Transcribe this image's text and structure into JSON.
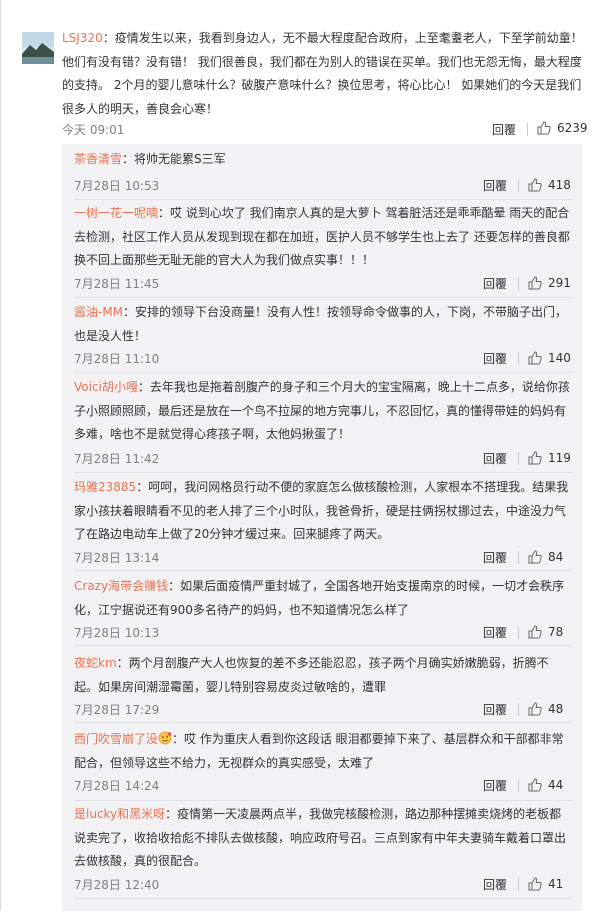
{
  "main_comment": {
    "username": "LSJ320",
    "text": "：疫情发生以来，我看到身边人，无不最大程度配合政府，上至耄耋老人，下至学前幼童！他们有没有错？没有错！ 我们很善良，我们都在为别人的错误在买单。我们也无怨无悔，最大程度的支持。 2个月的婴儿意味什么？破腹产意味什么？换位思考，将心比心！ 如果她们的今天是我们很多人的明天，善良会心寒！",
    "time": "今天 09:01",
    "reply_label": "回覆",
    "likes": "6239"
  },
  "replies": [
    {
      "username": "茶香清雪",
      "text": "：将帅无能累S三军",
      "time": "7月28日 10:53",
      "reply_label": "回覆",
      "likes": "418"
    },
    {
      "username": "一树一花一呢喃",
      "text": "：哎 说到心坎了 我们南京人真的是大萝卜 驾着脏活还是乖乖酷晕 雨天的配合去检测，社区工作人员从发现到现在都在加班，医护人员不够学生也上去了 还要怎样的善良都换不回上面那些无耻无能的官大人为我们做点实事！！！",
      "time": "7月28日 11:45",
      "reply_label": "回覆",
      "likes": "291"
    },
    {
      "username": "酱油-MM",
      "text": "：安排的领导下台没商量！没有人性！按领导命令做事的人，下岗，不带脑子出门，也是没人性！",
      "time": "7月28日 11:10",
      "reply_label": "回覆",
      "likes": "140"
    },
    {
      "username": "Voici胡小嘎",
      "text": "：去年我也是拖着剖腹产的身子和三个月大的宝宝隔离，晚上十二点多，说给你孩子小照顾照顾，最后还是放在一个鸟不拉屎的地方完事儿，不忍回忆，真的懂得带娃的妈妈有多难，啥也不是就觉得心疼孩子啊，太他妈揪蛋了！",
      "time": "7月28日 11:42",
      "reply_label": "回覆",
      "likes": "119"
    },
    {
      "username": "玛雅23885",
      "text": "：呵呵，我问网格员行动不便的家庭怎么做核酸检测，人家根本不搭理我。结果我家小孩扶着眼睛看不见的老人排了三个小时队，我爸骨折，硬是拄俩拐杖挪过去，中途没力气了在路边电动车上做了20分钟才缓过来。回来腿疼了两天。",
      "time": "7月28日 13:14",
      "reply_label": "回覆",
      "likes": "84"
    },
    {
      "username": "Crazy海带会赚钱",
      "text": "：如果后面疫情严重封城了，全国各地开始支援南京的时候，一切才会秩序化，江宁据说还有900多名待产的妈妈，也不知道情况怎么样了",
      "time": "7月28日 10:13",
      "reply_label": "回覆",
      "likes": "78"
    },
    {
      "username": "夜蛇km",
      "text": "：两个月剖腹产大人也恢复的差不多还能忍忍，孩子两个月确实娇嫩脆弱，折腾不起。如果房间潮湿霉菌，婴儿特别容易皮炎过敏啥的，遭罪",
      "time": "7月28日 17:29",
      "reply_label": "回覆",
      "likes": "48"
    },
    {
      "username": "西门吹雪崩了没",
      "text": "：哎 作为重庆人看到你这段话 眼泪都要掉下来了、基层群众和干部都非常配合，但领导这些不给力，无视群众的真实感受，太难了",
      "time": "7月28日 14:24",
      "reply_label": "回覆",
      "likes": "44",
      "emoji": "face-emoji-icon"
    },
    {
      "username": "是lucky和黑米呀",
      "text": "：疫情第一天凌晨两点半，我做完核酸检测，路边那种摆摊卖烧烤的老板都说卖完了，收拾收拾彪不排队去做核酸，响应政府号召。三点到家有中年夫妻骑车戴着口罩出去做核酸，真的很配合。",
      "time": "7月28日 12:40",
      "reply_label": "回覆",
      "likes": "41"
    }
  ],
  "colors": {
    "username": "#eb7350",
    "reply_bg": "#f2f2f5",
    "meta": "#808080"
  }
}
